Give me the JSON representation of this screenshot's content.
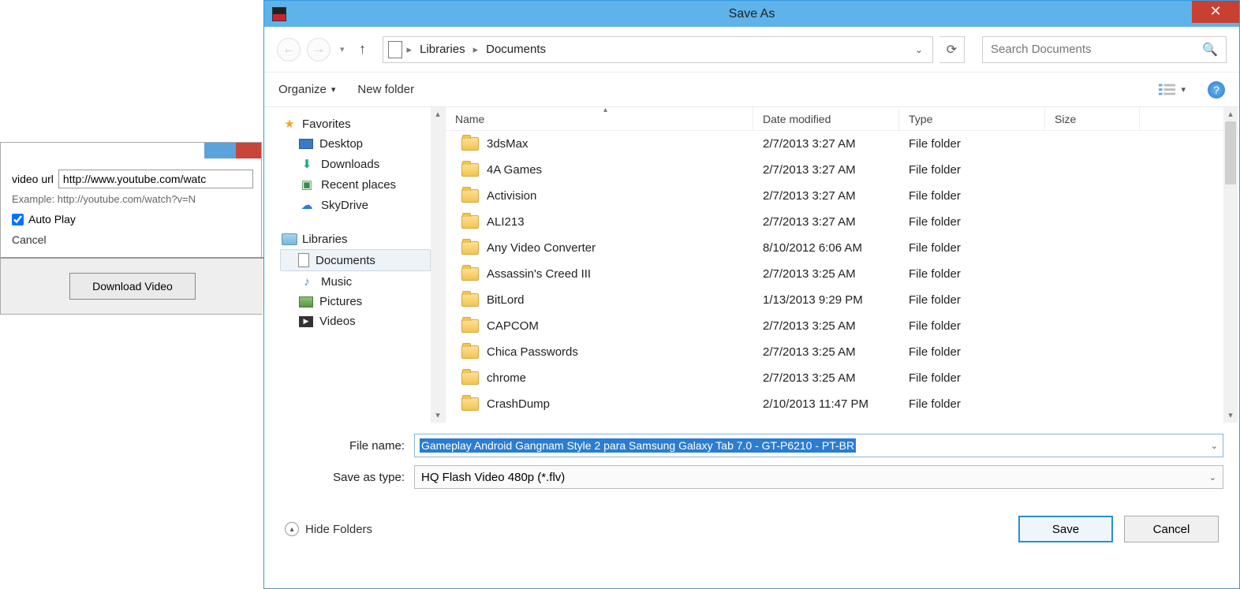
{
  "bg": {
    "url_label": "video url",
    "url_value": "http://www.youtube.com/watc",
    "example": "Example: http://youtube.com/watch?v=N",
    "autoplay_label": "Auto Play",
    "cancel_label": "Cancel",
    "download_label": "Download Video"
  },
  "dialog": {
    "title": "Save As",
    "breadcrumb": {
      "libraries": "Libraries",
      "documents": "Documents"
    },
    "search_placeholder": "Search Documents",
    "organize": "Organize",
    "newfolder": "New folder",
    "columns": {
      "name": "Name",
      "date": "Date modified",
      "type": "Type",
      "size": "Size"
    },
    "nav": {
      "favorites": "Favorites",
      "desktop": "Desktop",
      "downloads": "Downloads",
      "recent": "Recent places",
      "skydrive": "SkyDrive",
      "libraries": "Libraries",
      "documents": "Documents",
      "music": "Music",
      "pictures": "Pictures",
      "videos": "Videos"
    },
    "files": [
      {
        "name": "3dsMax",
        "date": "2/7/2013 3:27 AM",
        "type": "File folder"
      },
      {
        "name": "4A Games",
        "date": "2/7/2013 3:27 AM",
        "type": "File folder"
      },
      {
        "name": "Activision",
        "date": "2/7/2013 3:27 AM",
        "type": "File folder"
      },
      {
        "name": "ALI213",
        "date": "2/7/2013 3:27 AM",
        "type": "File folder"
      },
      {
        "name": "Any Video Converter",
        "date": "8/10/2012 6:06 AM",
        "type": "File folder"
      },
      {
        "name": "Assassin's Creed III",
        "date": "2/7/2013 3:25 AM",
        "type": "File folder"
      },
      {
        "name": "BitLord",
        "date": "1/13/2013 9:29 PM",
        "type": "File folder"
      },
      {
        "name": "CAPCOM",
        "date": "2/7/2013 3:25 AM",
        "type": "File folder"
      },
      {
        "name": "Chica Passwords",
        "date": "2/7/2013 3:25 AM",
        "type": "File folder"
      },
      {
        "name": "chrome",
        "date": "2/7/2013 3:25 AM",
        "type": "File folder"
      },
      {
        "name": "CrashDump",
        "date": "2/10/2013 11:47 PM",
        "type": "File folder"
      }
    ],
    "filename_label": "File name:",
    "filename_value": "Gameplay Android Gangnam Style 2 para Samsung Galaxy Tab 7.0 - GT-P6210 - PT-BR",
    "saveas_label": "Save as type:",
    "saveas_value": "HQ Flash Video 480p (*.flv)",
    "hide_folders": "Hide Folders",
    "save": "Save",
    "cancel": "Cancel"
  }
}
